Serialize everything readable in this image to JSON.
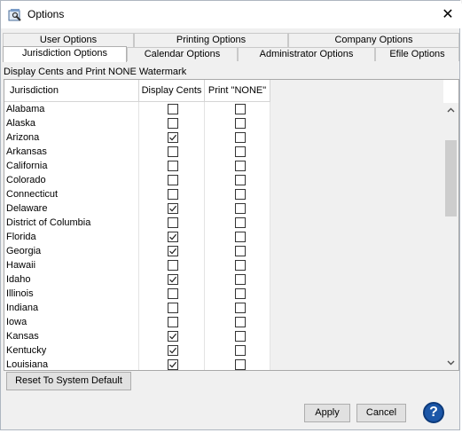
{
  "window": {
    "title": "Options",
    "close_glyph": "✕"
  },
  "tabs_row1": [
    {
      "label": "User Options"
    },
    {
      "label": "Printing Options"
    },
    {
      "label": "Company Options"
    }
  ],
  "tabs_row2": [
    {
      "label": "Jurisdiction Options",
      "active": true
    },
    {
      "label": "Calendar Options"
    },
    {
      "label": "Administrator Options"
    },
    {
      "label": "Efile Options"
    }
  ],
  "panel": {
    "label": "Display Cents and Print NONE Watermark"
  },
  "table": {
    "columns": [
      "Jurisdiction",
      "Display Cents",
      "Print \"NONE\""
    ],
    "rows": [
      {
        "name": "Alabama",
        "cents": false,
        "none": false
      },
      {
        "name": "Alaska",
        "cents": false,
        "none": false
      },
      {
        "name": "Arizona",
        "cents": true,
        "none": false
      },
      {
        "name": "Arkansas",
        "cents": false,
        "none": false
      },
      {
        "name": "California",
        "cents": false,
        "none": false
      },
      {
        "name": "Colorado",
        "cents": false,
        "none": false
      },
      {
        "name": "Connecticut",
        "cents": false,
        "none": false
      },
      {
        "name": "Delaware",
        "cents": true,
        "none": false
      },
      {
        "name": "District of Columbia",
        "cents": false,
        "none": false
      },
      {
        "name": "Florida",
        "cents": true,
        "none": false
      },
      {
        "name": "Georgia",
        "cents": true,
        "none": false
      },
      {
        "name": "Hawaii",
        "cents": false,
        "none": false
      },
      {
        "name": "Idaho",
        "cents": true,
        "none": false
      },
      {
        "name": "Illinois",
        "cents": false,
        "none": false
      },
      {
        "name": "Indiana",
        "cents": false,
        "none": false
      },
      {
        "name": "Iowa",
        "cents": false,
        "none": false
      },
      {
        "name": "Kansas",
        "cents": true,
        "none": false
      },
      {
        "name": "Kentucky",
        "cents": true,
        "none": false
      },
      {
        "name": "Louisiana",
        "cents": true,
        "none": false
      }
    ]
  },
  "buttons": {
    "reset": "Reset To System Default",
    "apply": "Apply",
    "cancel": "Cancel",
    "help": "?"
  },
  "icons": {
    "app": "options-app-icon",
    "help": "help-icon",
    "close": "close-icon"
  },
  "colors": {
    "help_bg": "#1c57a8",
    "window_bg": "#f0f0f0"
  }
}
